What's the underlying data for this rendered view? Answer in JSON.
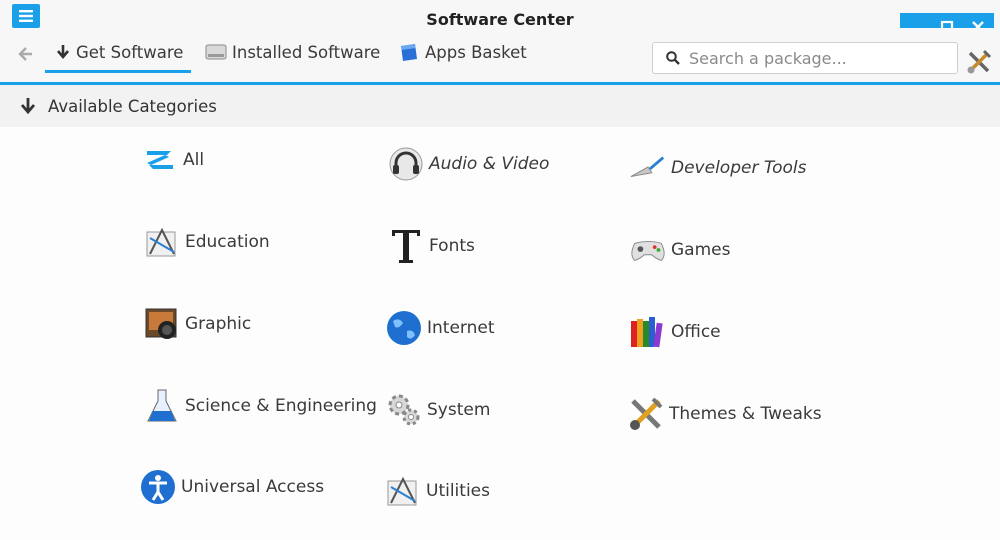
{
  "window": {
    "title": "Software Center"
  },
  "toolbar": {
    "tabs": [
      {
        "label": "Get Software",
        "icon": "download-arrow-icon",
        "active": true
      },
      {
        "label": "Installed Software",
        "icon": "drive-icon",
        "active": false
      },
      {
        "label": "Apps Basket",
        "icon": "basket-icon",
        "active": false
      }
    ],
    "search_placeholder": "Search a package..."
  },
  "header": {
    "label": "Available Categories"
  },
  "categories": [
    {
      "label": "All",
      "icon": "zorin-logo-icon"
    },
    {
      "label": "Audio & Video",
      "icon": "headphones-icon"
    },
    {
      "label": "Developer Tools",
      "icon": "trowel-icon"
    },
    {
      "label": "Education",
      "icon": "drafting-icon"
    },
    {
      "label": "Fonts",
      "icon": "font-t-icon"
    },
    {
      "label": "Games",
      "icon": "gamepad-icon"
    },
    {
      "label": "Graphic",
      "icon": "camera-icon"
    },
    {
      "label": "Internet",
      "icon": "globe-icon"
    },
    {
      "label": "Office",
      "icon": "books-icon"
    },
    {
      "label": "Science & Engineering",
      "icon": "flask-icon"
    },
    {
      "label": "System",
      "icon": "gears-icon"
    },
    {
      "label": "Themes & Tweaks",
      "icon": "tools-icon"
    },
    {
      "label": "Universal Access",
      "icon": "accessibility-icon"
    },
    {
      "label": "Utilities",
      "icon": "drafting-icon"
    }
  ],
  "colors": {
    "accent": "#1aa0e8",
    "background": "#fafafa"
  }
}
